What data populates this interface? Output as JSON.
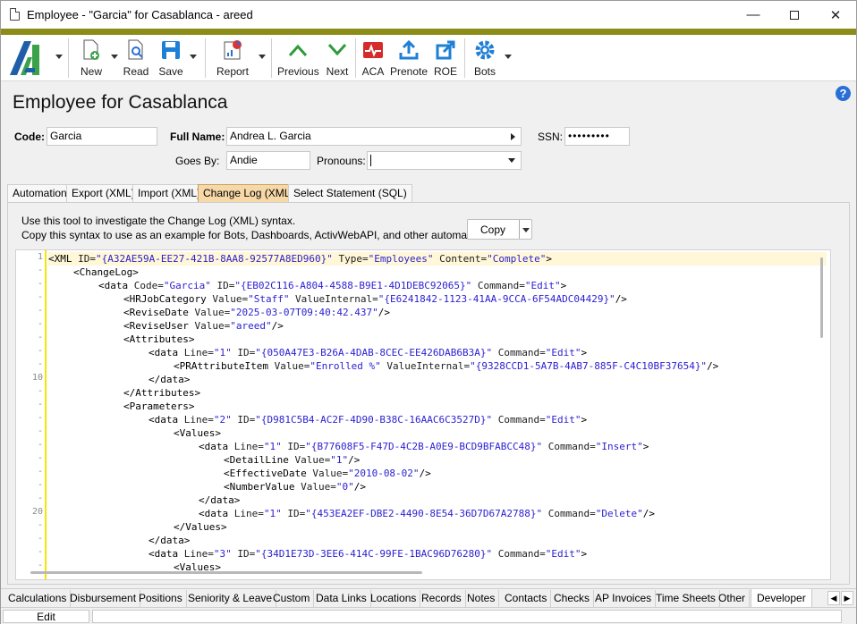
{
  "window": {
    "title": "Employee - \"Garcia\" for Casablanca - areed"
  },
  "toolbar": {
    "new": "New",
    "read": "Read",
    "save": "Save",
    "report": "Report",
    "previous": "Previous",
    "next": "Next",
    "aca": "ACA",
    "prenote": "Prenote",
    "roe": "ROE",
    "bots": "Bots"
  },
  "header": {
    "title": "Employee for Casablanca"
  },
  "form": {
    "code_label": "Code:",
    "code_value": "Garcia",
    "fullname_label": "Full Name:",
    "fullname_value": "Andrea L. Garcia",
    "ssn_label": "SSN:",
    "ssn_value": "•••••••••",
    "goesby_label": "Goes By:",
    "goesby_value": "Andie",
    "pronouns_label": "Pronouns:",
    "pronouns_value": ""
  },
  "tabs": [
    "Automation",
    "Export (XML)",
    "Import (XML)",
    "Change Log (XML)",
    "Select Statement (SQL)"
  ],
  "panel": {
    "info_line1": "Use this tool to investigate the Change Log (XML) syntax.",
    "info_line2": "Copy this syntax to use as an example for Bots, Dashboards, ActivWebAPI, and other automation.",
    "copy_label": "Copy"
  },
  "gutter": [
    "1",
    "-",
    "-",
    "-",
    "-",
    "-",
    "-",
    "-",
    "-",
    "10",
    "-",
    "-",
    "-",
    "-",
    "-",
    "-",
    "-",
    "-",
    "-",
    "20",
    "-",
    "-",
    "-",
    "-"
  ],
  "code_lines": [
    {
      "indent": 0,
      "parts": [
        [
          "tg",
          "<XML"
        ],
        [
          "an",
          " ID="
        ],
        [
          "av",
          "\"{A32AE59A-EE27-421B-8AA8-92577A8ED960}\""
        ],
        [
          "an",
          " Type="
        ],
        [
          "av",
          "\"Employees\""
        ],
        [
          "an",
          " Content="
        ],
        [
          "av",
          "\"Complete\""
        ],
        [
          "tg",
          ">"
        ]
      ]
    },
    {
      "indent": 1,
      "parts": [
        [
          "tg",
          "<ChangeLog>"
        ]
      ]
    },
    {
      "indent": 2,
      "parts": [
        [
          "tg",
          "<data"
        ],
        [
          "an",
          " Code="
        ],
        [
          "av",
          "\"Garcia\""
        ],
        [
          "an",
          " ID="
        ],
        [
          "av",
          "\"{EB02C116-A804-4588-B9E1-4D1DEBC92065}\""
        ],
        [
          "an",
          " Command="
        ],
        [
          "av",
          "\"Edit\""
        ],
        [
          "tg",
          ">"
        ]
      ]
    },
    {
      "indent": 3,
      "parts": [
        [
          "tg",
          "<HRJobCategory"
        ],
        [
          "an",
          " Value="
        ],
        [
          "av",
          "\"Staff\""
        ],
        [
          "an",
          " ValueInternal="
        ],
        [
          "av",
          "\"{E6241842-1123-41AA-9CCA-6F54ADC04429}\""
        ],
        [
          "tg",
          "/>"
        ]
      ]
    },
    {
      "indent": 3,
      "parts": [
        [
          "tg",
          "<ReviseDate"
        ],
        [
          "an",
          " Value="
        ],
        [
          "av",
          "\"2025-03-07T09:40:42.437\""
        ],
        [
          "tg",
          "/>"
        ]
      ]
    },
    {
      "indent": 3,
      "parts": [
        [
          "tg",
          "<ReviseUser"
        ],
        [
          "an",
          " Value="
        ],
        [
          "av",
          "\"areed\""
        ],
        [
          "tg",
          "/>"
        ]
      ]
    },
    {
      "indent": 3,
      "parts": [
        [
          "tg",
          "<Attributes>"
        ]
      ]
    },
    {
      "indent": 4,
      "parts": [
        [
          "tg",
          "<data"
        ],
        [
          "an",
          " Line="
        ],
        [
          "av",
          "\"1\""
        ],
        [
          "an",
          " ID="
        ],
        [
          "av",
          "\"{050A47E3-B26A-4DAB-8CEC-EE426DAB6B3A}\""
        ],
        [
          "an",
          " Command="
        ],
        [
          "av",
          "\"Edit\""
        ],
        [
          "tg",
          ">"
        ]
      ]
    },
    {
      "indent": 5,
      "parts": [
        [
          "tg",
          "<PRAttributeItem"
        ],
        [
          "an",
          " Value="
        ],
        [
          "av",
          "\"Enrolled %\""
        ],
        [
          "an",
          " ValueInternal="
        ],
        [
          "av",
          "\"{9328CCD1-5A7B-4AB7-885F-C4C10BF37654}\""
        ],
        [
          "tg",
          "/>"
        ]
      ]
    },
    {
      "indent": 4,
      "parts": [
        [
          "tg",
          "</data>"
        ]
      ]
    },
    {
      "indent": 3,
      "parts": [
        [
          "tg",
          "</Attributes>"
        ]
      ]
    },
    {
      "indent": 3,
      "parts": [
        [
          "tg",
          "<Parameters>"
        ]
      ]
    },
    {
      "indent": 4,
      "parts": [
        [
          "tg",
          "<data"
        ],
        [
          "an",
          " Line="
        ],
        [
          "av",
          "\"2\""
        ],
        [
          "an",
          " ID="
        ],
        [
          "av",
          "\"{D981C5B4-AC2F-4D90-B38C-16AAC6C3527D}\""
        ],
        [
          "an",
          " Command="
        ],
        [
          "av",
          "\"Edit\""
        ],
        [
          "tg",
          ">"
        ]
      ]
    },
    {
      "indent": 5,
      "parts": [
        [
          "tg",
          "<Values>"
        ]
      ]
    },
    {
      "indent": 6,
      "parts": [
        [
          "tg",
          "<data"
        ],
        [
          "an",
          " Line="
        ],
        [
          "av",
          "\"1\""
        ],
        [
          "an",
          " ID="
        ],
        [
          "av",
          "\"{B77608F5-F47D-4C2B-A0E9-BCD9BFABCC48}\""
        ],
        [
          "an",
          " Command="
        ],
        [
          "av",
          "\"Insert\""
        ],
        [
          "tg",
          ">"
        ]
      ]
    },
    {
      "indent": 7,
      "parts": [
        [
          "tg",
          "<DetailLine"
        ],
        [
          "an",
          " Value="
        ],
        [
          "av",
          "\"1\""
        ],
        [
          "tg",
          "/>"
        ]
      ]
    },
    {
      "indent": 7,
      "parts": [
        [
          "tg",
          "<EffectiveDate"
        ],
        [
          "an",
          " Value="
        ],
        [
          "av",
          "\"2010-08-02\""
        ],
        [
          "tg",
          "/>"
        ]
      ]
    },
    {
      "indent": 7,
      "parts": [
        [
          "tg",
          "<NumberValue"
        ],
        [
          "an",
          " Value="
        ],
        [
          "av",
          "\"0\""
        ],
        [
          "tg",
          "/>"
        ]
      ]
    },
    {
      "indent": 6,
      "parts": [
        [
          "tg",
          "</data>"
        ]
      ]
    },
    {
      "indent": 6,
      "parts": [
        [
          "tg",
          "<data"
        ],
        [
          "an",
          " Line="
        ],
        [
          "av",
          "\"1\""
        ],
        [
          "an",
          " ID="
        ],
        [
          "av",
          "\"{453EA2EF-DBE2-4490-8E54-36D7D67A2788}\""
        ],
        [
          "an",
          " Command="
        ],
        [
          "av",
          "\"Delete\""
        ],
        [
          "tg",
          "/>"
        ]
      ]
    },
    {
      "indent": 5,
      "parts": [
        [
          "tg",
          "</Values>"
        ]
      ]
    },
    {
      "indent": 4,
      "parts": [
        [
          "tg",
          "</data>"
        ]
      ]
    },
    {
      "indent": 4,
      "parts": [
        [
          "tg",
          "<data"
        ],
        [
          "an",
          " Line="
        ],
        [
          "av",
          "\"3\""
        ],
        [
          "an",
          " ID="
        ],
        [
          "av",
          "\"{34D1E73D-3EE6-414C-99FE-1BAC96D76280}\""
        ],
        [
          "an",
          " Command="
        ],
        [
          "av",
          "\"Edit\""
        ],
        [
          "tg",
          ">"
        ]
      ]
    },
    {
      "indent": 5,
      "parts": [
        [
          "tg",
          "<Values>"
        ]
      ]
    }
  ],
  "bottom_tabs": [
    "Calculations",
    "Disbursement",
    "Positions",
    "Seniority & Leave",
    "Custom",
    "Data Links",
    "Locations",
    "Records",
    "Notes",
    "Contacts",
    "Checks",
    "AP Invoices",
    "Time Sheets",
    "Other",
    "Developer"
  ],
  "status": {
    "mode": "Edit"
  },
  "colors": {
    "accent_bar": "#8c8c19",
    "selected_tab": "#f7d9a8",
    "code_value": "#2a1fd0"
  }
}
